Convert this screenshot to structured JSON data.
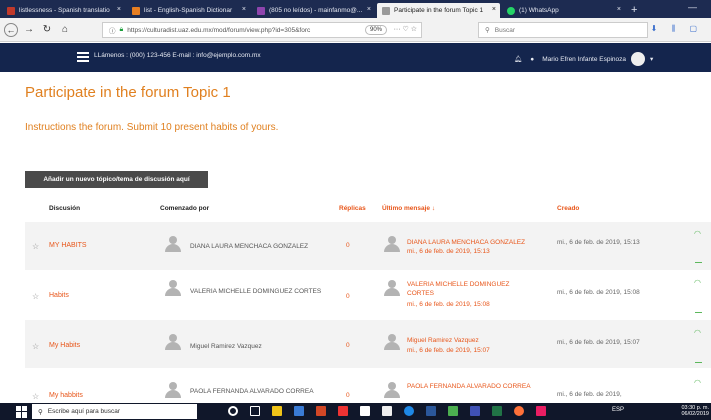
{
  "browser": {
    "tabs": [
      {
        "label": "listlessness - Spanish translatio",
        "color": "#c0392b"
      },
      {
        "label": "list - English-Spanish Dictionar",
        "color": "#e67e22"
      },
      {
        "label": "(805 no leídos) - mainfanmo@...",
        "color": "#8e44ad"
      },
      {
        "label": "Participate in the forum Topic 1",
        "color": "#999999"
      },
      {
        "label": "(1) WhatsApp",
        "color": "#25d366"
      }
    ],
    "url": "https://culturadist.uaz.edu.mx/mod/forum/view.php?id=305&forc",
    "zoom": "90%",
    "search_placeholder": "Buscar"
  },
  "site_header": {
    "contact": "LLámenos : (000) 123-456  E-mail : info@ejemplo.com.mx",
    "user_name": "Mario Efren Infante Espinoza"
  },
  "page": {
    "title": "Participate in the forum Topic 1",
    "instructions": "Instructions the forum. Submit 10 present habits of yours.",
    "add_button": "Añadir un nuevo tópico/tema de discusión aquí"
  },
  "table": {
    "headers": {
      "discussion": "Discusión",
      "started_by": "Comenzado por",
      "replies": "Réplicas",
      "last_post": "Último mensaje ↓",
      "created": "Creado"
    },
    "rows": [
      {
        "discussion": "MY HABITS",
        "started_by": "DIANA LAURA MENCHACA GONZALEZ",
        "replies": "0",
        "last_author": "DIANA LAURA MENCHACA GONZALEZ",
        "last_date": "mi., 6 de feb. de 2019, 15:13",
        "created": "mi., 6 de feb. de 2019, 15:13"
      },
      {
        "discussion": "Habits",
        "started_by": "VALERIA MICHELLE DOMINGUEZ CORTES",
        "replies": "0",
        "last_author": "VALERIA MICHELLE DOMINGUEZ CORTES",
        "last_date": "mi., 6 de feb. de 2019, 15:08",
        "created": "mi., 6 de feb. de 2019, 15:08"
      },
      {
        "discussion": "My Habits",
        "started_by": "Miguel Ramirez Vazquez",
        "replies": "0",
        "last_author": "Miguel Ramirez Vazquez",
        "last_date": "mi., 6 de feb. de 2019, 15:07",
        "created": "mi., 6 de feb. de 2019, 15:07"
      },
      {
        "discussion": "My habbits",
        "started_by": "PAOLA FERNANDA ALVARADO CORREA",
        "replies": "0",
        "last_author": "PAOLA FERNANDA ALVARADO CORREA",
        "last_date": "",
        "created": "mi., 6 de feb. de 2019,"
      }
    ]
  },
  "taskbar": {
    "search": "Escribe aquí para buscar",
    "tray": "ESP",
    "time": "03:30 p. m.",
    "date": "06/02/2019"
  }
}
